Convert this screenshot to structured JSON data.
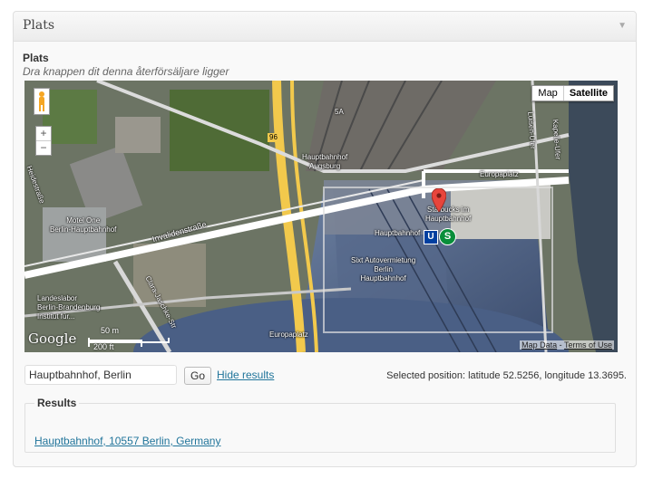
{
  "postbox": {
    "title": "Plats",
    "toggle_icon": "triangle-down-icon"
  },
  "field": {
    "label": "Plats",
    "description": "Dra knappen dit denna återförsäljare ligger"
  },
  "map": {
    "type_options": [
      "Map",
      "Satellite"
    ],
    "active_type": "Satellite",
    "zoom_in": "+",
    "zoom_out": "−",
    "labels": {
      "hbf_augsburg": "Hauptbahnhof\nAugsburg",
      "road_96": "96",
      "europaplatz": "Europaplatz",
      "starbucks": "Starbucks im\nHauptbahnhof",
      "hauptbahnhof": "Hauptbahnhof",
      "motel_one": "Motel One\nBerlin-Hauptbahnhof",
      "sixt": "Sixt Autovermietung\nBerlin\nHauptbahnhof",
      "invalidenstrasse": "Invalidenstraße",
      "clara": "Clara-Jaschke-Str",
      "landeslabor": "Landeslabor\nBerlin-Brandenburg\nInstitut für...",
      "europaplatz_bottom": "Europaplatz",
      "luisen": "Luisen-Ufer",
      "kapelle": "Kapelle-Ufer",
      "heidestrasse": "Heidestraße",
      "sa": "5A"
    },
    "scale_m": "50 m",
    "scale_ft": "200 ft",
    "logo": "Google",
    "footer_data": "Map Data",
    "footer_sep": " - ",
    "footer_terms": "Terms of Use",
    "colors": {
      "marker": "#e8453c",
      "ubahn": "#003fa0",
      "sbahn": "#088e3a",
      "roads": "#f2c94c"
    }
  },
  "search": {
    "value": "Hauptbahnhof, Berlin",
    "go_label": "Go",
    "hide_label": "Hide results",
    "selected_position": "Selected position: latitude 52.5256, longitude 13.3695."
  },
  "results": {
    "legend": "Results",
    "items": [
      "Hauptbahnhof, 10557 Berlin, Germany"
    ]
  }
}
